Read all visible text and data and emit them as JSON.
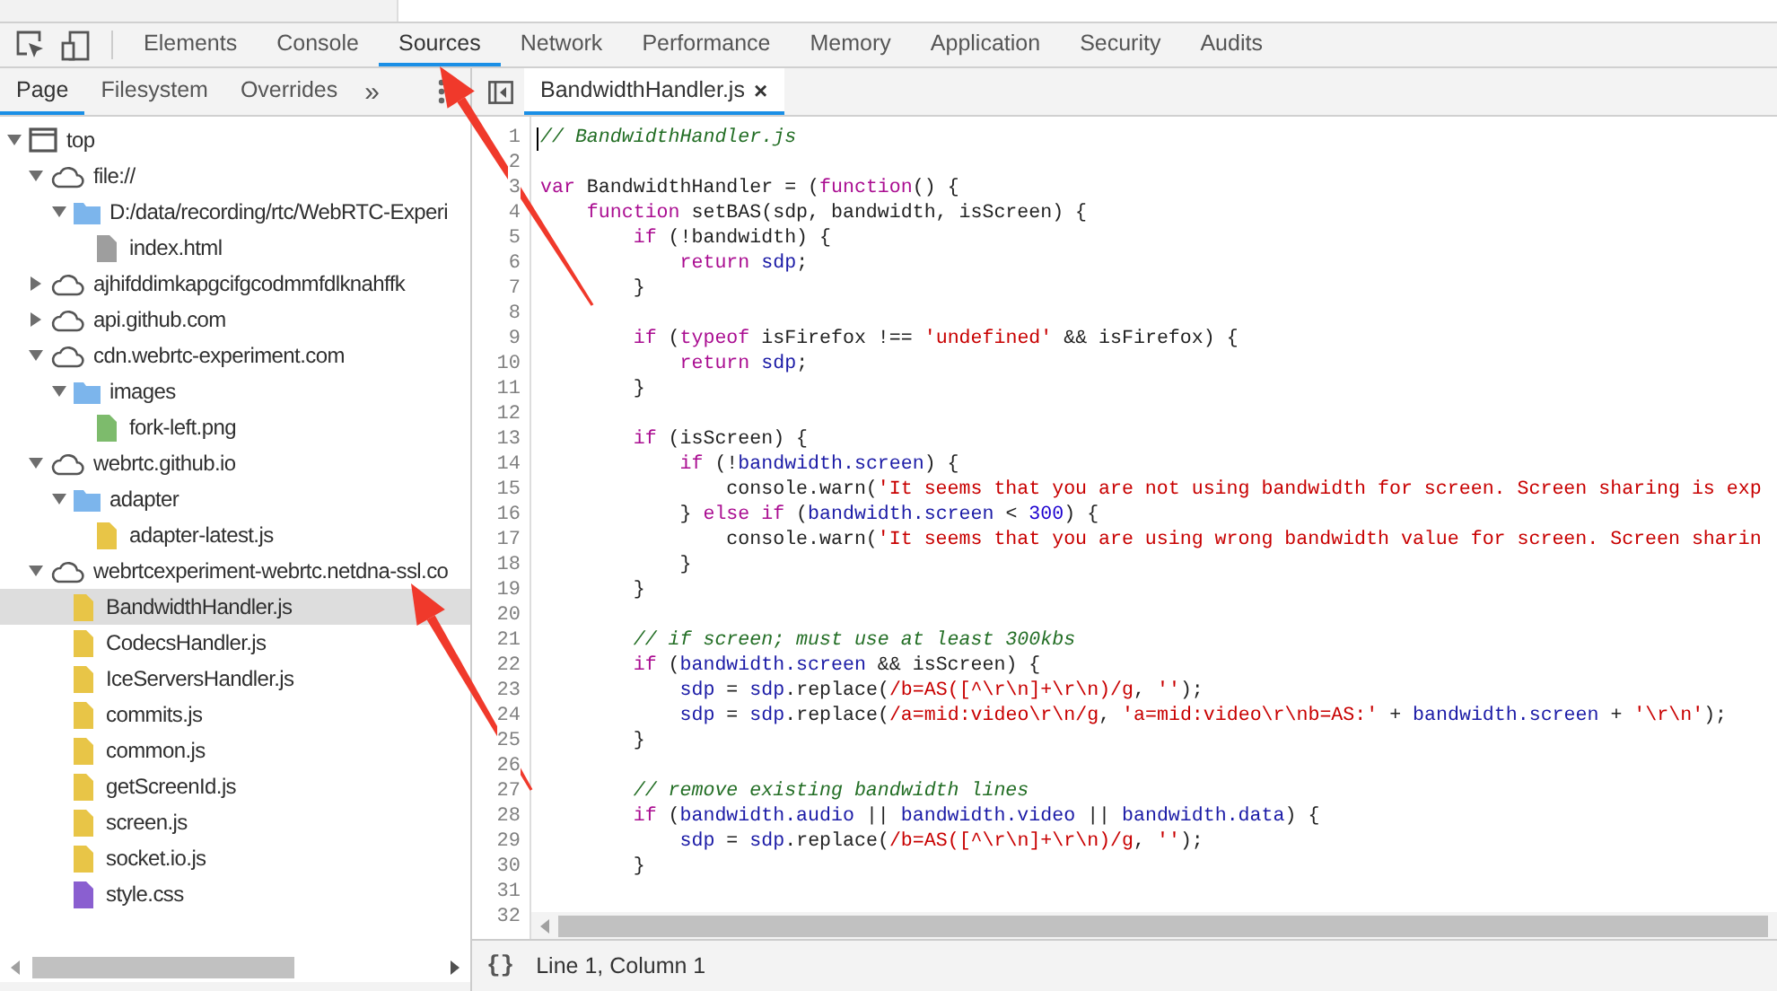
{
  "main_tabs": [
    {
      "label": "Elements",
      "selected": false
    },
    {
      "label": "Console",
      "selected": false
    },
    {
      "label": "Sources",
      "selected": true
    },
    {
      "label": "Network",
      "selected": false
    },
    {
      "label": "Performance",
      "selected": false
    },
    {
      "label": "Memory",
      "selected": false
    },
    {
      "label": "Application",
      "selected": false
    },
    {
      "label": "Security",
      "selected": false
    },
    {
      "label": "Audits",
      "selected": false
    }
  ],
  "navigator": {
    "tabs": [
      {
        "label": "Page",
        "selected": true
      },
      {
        "label": "Filesystem",
        "selected": false
      },
      {
        "label": "Overrides",
        "selected": false
      }
    ],
    "more": "»",
    "tree": [
      {
        "kind": "frame",
        "label": "top",
        "expanded": true,
        "selected": false,
        "children": [
          {
            "kind": "domain",
            "label": "file://",
            "expanded": true,
            "selected": false,
            "children": [
              {
                "kind": "folder",
                "label": "D:/data/recording/rtc/WebRTC-Experi",
                "expanded": true,
                "selected": false,
                "children": [
                  {
                    "kind": "file",
                    "label": "index.html",
                    "color": "#9e9e9e",
                    "selected": false
                  }
                ]
              }
            ]
          },
          {
            "kind": "domain",
            "label": "ajhifddimkapgcifgcodmmfdlknahffk",
            "expanded": false,
            "selected": false
          },
          {
            "kind": "domain",
            "label": "api.github.com",
            "expanded": false,
            "selected": false
          },
          {
            "kind": "domain",
            "label": "cdn.webrtc-experiment.com",
            "expanded": true,
            "selected": false,
            "children": [
              {
                "kind": "folder",
                "label": "images",
                "expanded": true,
                "selected": false,
                "children": [
                  {
                    "kind": "file",
                    "label": "fork-left.png",
                    "color": "#7dbb6c",
                    "selected": false
                  }
                ]
              }
            ]
          },
          {
            "kind": "domain",
            "label": "webrtc.github.io",
            "expanded": true,
            "selected": false,
            "children": [
              {
                "kind": "folder",
                "label": "adapter",
                "expanded": true,
                "selected": false,
                "children": [
                  {
                    "kind": "file",
                    "label": "adapter-latest.js",
                    "color": "#e8c547",
                    "selected": false
                  }
                ]
              }
            ]
          },
          {
            "kind": "domain",
            "label": "webrtcexperiment-webrtc.netdna-ssl.co",
            "expanded": true,
            "selected": false,
            "children": [
              {
                "kind": "file",
                "label": "BandwidthHandler.js",
                "color": "#e8c547",
                "selected": true
              },
              {
                "kind": "file",
                "label": "CodecsHandler.js",
                "color": "#e8c547",
                "selected": false
              },
              {
                "kind": "file",
                "label": "IceServersHandler.js",
                "color": "#e8c547",
                "selected": false
              },
              {
                "kind": "file",
                "label": "commits.js",
                "color": "#e8c547",
                "selected": false
              },
              {
                "kind": "file",
                "label": "common.js",
                "color": "#e8c547",
                "selected": false
              },
              {
                "kind": "file",
                "label": "getScreenId.js",
                "color": "#e8c547",
                "selected": false
              },
              {
                "kind": "file",
                "label": "screen.js",
                "color": "#e8c547",
                "selected": false
              },
              {
                "kind": "file",
                "label": "socket.io.js",
                "color": "#e8c547",
                "selected": false
              },
              {
                "kind": "file",
                "label": "style.css",
                "color": "#8a5fd0",
                "selected": false
              }
            ]
          }
        ]
      }
    ]
  },
  "editor": {
    "tabs": [
      {
        "label": "BandwidthHandler.js",
        "close": "×",
        "selected": true
      }
    ],
    "lines": [
      {
        "number": "1",
        "tokens": [
          {
            "kind": "comment",
            "text": "// BandwidthHandler.js"
          }
        ]
      },
      {
        "number": "2"
      },
      {
        "number": "3",
        "tokens": [
          {
            "kind": "keyword",
            "text": "var"
          },
          {
            "kind": "plain",
            "text": " BandwidthHandler = ("
          },
          {
            "kind": "keyword",
            "text": "function"
          },
          {
            "kind": "plain",
            "text": "() {"
          }
        ]
      },
      {
        "number": "4",
        "tokens": [
          {
            "kind": "keyword",
            "text": "    function"
          },
          {
            "kind": "plain",
            "text": " setBAS(sdp, bandwidth, isScreen) {"
          }
        ]
      },
      {
        "number": "5",
        "tokens": [
          {
            "kind": "keyword",
            "text": "        if"
          },
          {
            "kind": "plain",
            "text": " (!bandwidth) {"
          }
        ]
      },
      {
        "number": "6",
        "tokens": [
          {
            "kind": "keyword",
            "text": "            return"
          },
          {
            "kind": "variable",
            "text": " sdp"
          },
          {
            "kind": "plain",
            "text": ";"
          }
        ]
      },
      {
        "number": "7",
        "tokens": [
          {
            "kind": "plain",
            "text": "        }"
          }
        ]
      },
      {
        "number": "8"
      },
      {
        "number": "9",
        "tokens": [
          {
            "kind": "keyword",
            "text": "        if"
          },
          {
            "kind": "plain",
            "text": " ("
          },
          {
            "kind": "keyword",
            "text": "typeof"
          },
          {
            "kind": "plain",
            "text": " isFirefox !== "
          },
          {
            "kind": "string",
            "text": "'undefined'"
          },
          {
            "kind": "plain",
            "text": " && isFirefox) {"
          }
        ]
      },
      {
        "number": "10",
        "tokens": [
          {
            "kind": "keyword",
            "text": "            return"
          },
          {
            "kind": "variable",
            "text": " sdp"
          },
          {
            "kind": "plain",
            "text": ";"
          }
        ]
      },
      {
        "number": "11",
        "tokens": [
          {
            "kind": "plain",
            "text": "        }"
          }
        ]
      },
      {
        "number": "12"
      },
      {
        "number": "13",
        "tokens": [
          {
            "kind": "keyword",
            "text": "        if"
          },
          {
            "kind": "plain",
            "text": " (isScreen) {"
          }
        ]
      },
      {
        "number": "14",
        "tokens": [
          {
            "kind": "keyword",
            "text": "            if"
          },
          {
            "kind": "plain",
            "text": " (!"
          },
          {
            "kind": "variable",
            "text": "bandwidth.screen"
          },
          {
            "kind": "plain",
            "text": ") {"
          }
        ]
      },
      {
        "number": "15",
        "tokens": [
          {
            "kind": "plain",
            "text": "                console.warn("
          },
          {
            "kind": "string",
            "text": "'It seems that you are not using bandwidth for screen. Screen sharing is exp"
          }
        ]
      },
      {
        "number": "16",
        "tokens": [
          {
            "kind": "plain",
            "text": "            } "
          },
          {
            "kind": "keyword",
            "text": "else if"
          },
          {
            "kind": "plain",
            "text": " ("
          },
          {
            "kind": "variable",
            "text": "bandwidth.screen"
          },
          {
            "kind": "plain",
            "text": " < "
          },
          {
            "kind": "number",
            "text": "300"
          },
          {
            "kind": "plain",
            "text": ") {"
          }
        ]
      },
      {
        "number": "17",
        "tokens": [
          {
            "kind": "plain",
            "text": "                console.warn("
          },
          {
            "kind": "string",
            "text": "'It seems that you are using wrong bandwidth value for screen. Screen sharin"
          }
        ]
      },
      {
        "number": "18",
        "tokens": [
          {
            "kind": "plain",
            "text": "            }"
          }
        ]
      },
      {
        "number": "19",
        "tokens": [
          {
            "kind": "plain",
            "text": "        }"
          }
        ]
      },
      {
        "number": "20"
      },
      {
        "number": "21",
        "tokens": [
          {
            "kind": "comment",
            "text": "        // if screen; must use at least 300kbs"
          }
        ]
      },
      {
        "number": "22",
        "tokens": [
          {
            "kind": "keyword",
            "text": "        if"
          },
          {
            "kind": "plain",
            "text": " ("
          },
          {
            "kind": "variable",
            "text": "bandwidth.screen"
          },
          {
            "kind": "plain",
            "text": " && isScreen) {"
          }
        ]
      },
      {
        "number": "23",
        "tokens": [
          {
            "kind": "variable",
            "text": "            sdp"
          },
          {
            "kind": "plain",
            "text": " = "
          },
          {
            "kind": "variable",
            "text": "sdp"
          },
          {
            "kind": "plain",
            "text": ".replace("
          },
          {
            "kind": "string",
            "text": "/b=AS([^\\r\\n]+\\r\\n)/g"
          },
          {
            "kind": "plain",
            "text": ", "
          },
          {
            "kind": "string",
            "text": "''"
          },
          {
            "kind": "plain",
            "text": ");"
          }
        ]
      },
      {
        "number": "24",
        "tokens": [
          {
            "kind": "variable",
            "text": "            sdp"
          },
          {
            "kind": "plain",
            "text": " = "
          },
          {
            "kind": "variable",
            "text": "sdp"
          },
          {
            "kind": "plain",
            "text": ".replace("
          },
          {
            "kind": "string",
            "text": "/a=mid:video\\r\\n/g"
          },
          {
            "kind": "plain",
            "text": ", "
          },
          {
            "kind": "string",
            "text": "'a=mid:video\\r\\nb=AS:'"
          },
          {
            "kind": "plain",
            "text": " + "
          },
          {
            "kind": "variable",
            "text": "bandwidth.screen"
          },
          {
            "kind": "plain",
            "text": " + "
          },
          {
            "kind": "string",
            "text": "'\\r\\n'"
          },
          {
            "kind": "plain",
            "text": ");"
          }
        ]
      },
      {
        "number": "25",
        "tokens": [
          {
            "kind": "plain",
            "text": "        }"
          }
        ]
      },
      {
        "number": "26"
      },
      {
        "number": "27",
        "tokens": [
          {
            "kind": "comment",
            "text": "        // remove existing bandwidth lines"
          }
        ]
      },
      {
        "number": "28",
        "tokens": [
          {
            "kind": "keyword",
            "text": "        if"
          },
          {
            "kind": "plain",
            "text": " ("
          },
          {
            "kind": "variable",
            "text": "bandwidth.audio"
          },
          {
            "kind": "plain",
            "text": " || "
          },
          {
            "kind": "variable",
            "text": "bandwidth.video"
          },
          {
            "kind": "plain",
            "text": " || "
          },
          {
            "kind": "variable",
            "text": "bandwidth.data"
          },
          {
            "kind": "plain",
            "text": ") {"
          }
        ]
      },
      {
        "number": "29",
        "tokens": [
          {
            "kind": "variable",
            "text": "            sdp"
          },
          {
            "kind": "plain",
            "text": " = "
          },
          {
            "kind": "variable",
            "text": "sdp"
          },
          {
            "kind": "plain",
            "text": ".replace("
          },
          {
            "kind": "string",
            "text": "/b=AS([^\\r\\n]+\\r\\n)/g"
          },
          {
            "kind": "plain",
            "text": ", "
          },
          {
            "kind": "string",
            "text": "''"
          },
          {
            "kind": "plain",
            "text": ");"
          }
        ]
      },
      {
        "number": "30",
        "tokens": [
          {
            "kind": "plain",
            "text": "        }"
          }
        ]
      },
      {
        "number": "31"
      },
      {
        "number": "32"
      }
    ]
  },
  "status_bar": {
    "format_button": "{}",
    "position": "Line 1, Column 1"
  }
}
